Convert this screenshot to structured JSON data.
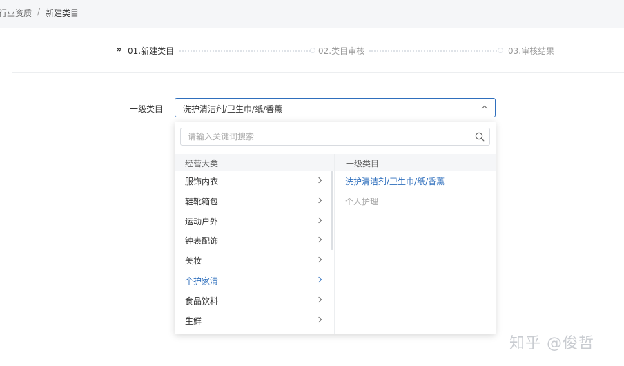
{
  "breadcrumb": {
    "prev": "行业资质",
    "separator": "/",
    "current": "新建类目"
  },
  "steps": [
    {
      "label": "01.新建类目",
      "state": "active"
    },
    {
      "label": "02.类目审核",
      "state": "pending"
    },
    {
      "label": "03.审核结果",
      "state": "pending"
    }
  ],
  "form": {
    "field_label": "一级类目",
    "select_value": "洗护清洁剂/卫生巾/纸/香薰"
  },
  "dropdown": {
    "search_placeholder": "请输入关键词搜索",
    "left_header": "经营大类",
    "right_header": "一级类目",
    "categories": [
      {
        "label": "服饰内衣",
        "active": false
      },
      {
        "label": "鞋靴箱包",
        "active": false
      },
      {
        "label": "运动户外",
        "active": false
      },
      {
        "label": "钟表配饰",
        "active": false
      },
      {
        "label": "美妆",
        "active": false
      },
      {
        "label": "个护家清",
        "active": true
      },
      {
        "label": "食品饮料",
        "active": false
      },
      {
        "label": "生鲜",
        "active": false
      }
    ],
    "subcategories": [
      {
        "label": "洗护清洁剂/卫生巾/纸/香薰",
        "state": "selected"
      },
      {
        "label": "个人护理",
        "state": "disabled"
      }
    ]
  },
  "watermark": "知乎 @俊哲",
  "colors": {
    "accent": "#2f6fbd",
    "muted": "#aaaaaa",
    "header_bg": "#f5f6f8"
  }
}
